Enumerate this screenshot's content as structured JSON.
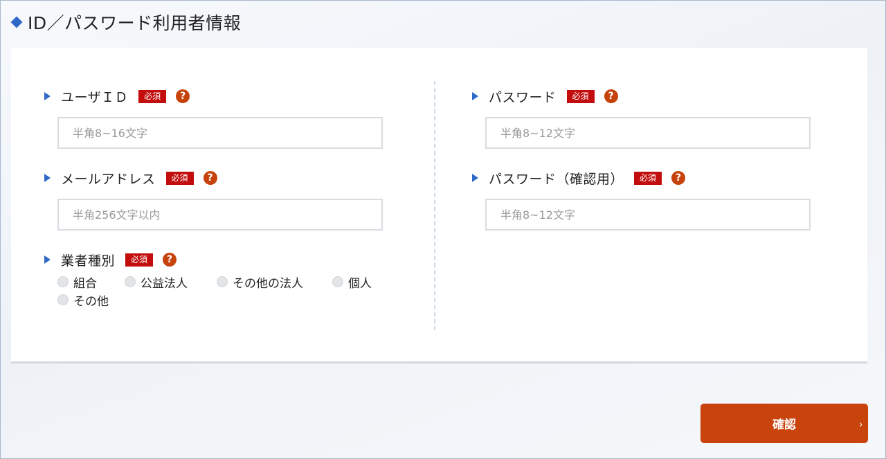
{
  "section": {
    "title": "ID／パスワード利用者情報"
  },
  "required_badge": "必須",
  "help_mark": "?",
  "fields": {
    "user_id": {
      "label": "ユーザＩＤ",
      "placeholder": "半角8~16文字"
    },
    "email": {
      "label": "メールアドレス",
      "placeholder": "半角256文字以内"
    },
    "business_type": {
      "label": "業者種別",
      "options": [
        "組合",
        "公益法人",
        "その他の法人",
        "個人",
        "その他"
      ]
    },
    "password": {
      "label": "パスワード",
      "placeholder": "半角8~12文字"
    },
    "password_confirm": {
      "label": "パスワード（確認用）",
      "placeholder": "半角8~12文字"
    }
  },
  "confirm_button": {
    "label": "確認",
    "arrow": "›"
  },
  "colors": {
    "accent_blue": "#2f69c8",
    "required_red": "#c30d0d",
    "help_orange": "#c7430c",
    "button_orange": "#c9430c"
  }
}
